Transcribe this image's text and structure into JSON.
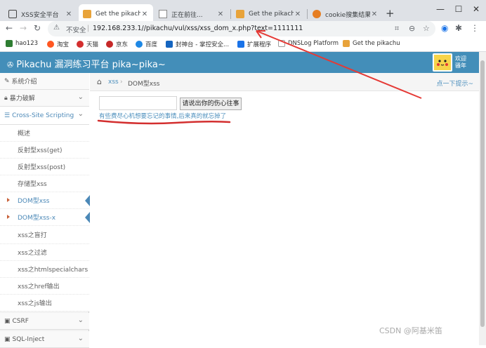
{
  "browser": {
    "tabs": [
      {
        "label": "XSS安全平台",
        "icon": "xss-favicon"
      },
      {
        "label": "Get the pikachu",
        "icon": "pikachu-favicon"
      },
      {
        "label": "正在前往...",
        "icon": "page-favicon"
      },
      {
        "label": "Get the pikachu",
        "icon": "pikachu-favicon"
      },
      {
        "label": "cookie搜集结果",
        "icon": "cookie-favicon"
      }
    ],
    "new_tab": "+",
    "address": {
      "security_label": "不安全",
      "url": "192.168.233.1//pikachu/vul/xss/xss_dom_x.php?text=1111111"
    },
    "bookmarks": [
      {
        "label": "hao123",
        "color": "#2e7d32"
      },
      {
        "label": "淘宝",
        "color": "#ff5722"
      },
      {
        "label": "天猫",
        "color": "#d32f2f"
      },
      {
        "label": "京东",
        "color": "#c62828"
      },
      {
        "label": "百度",
        "color": "#1e88e5"
      },
      {
        "label": "封神台 - 掌控安全...",
        "color": "#1565c0"
      },
      {
        "label": "扩展程序",
        "color": "#1a73e8"
      },
      {
        "label": "DNSLog Platform",
        "color": "#9e9e9e"
      },
      {
        "label": "Get the pikachu",
        "color": "#e8a33a"
      }
    ]
  },
  "page": {
    "title": "Pikachu 漏洞练习平台 pika~pika~",
    "welcome_line1": "欢迎",
    "welcome_line2": "骚年",
    "accent": "#438eb9"
  },
  "sidebar": {
    "groups": [
      {
        "label": "系统介绍",
        "icon": "wrench-icon"
      },
      {
        "label": "暴力破解",
        "icon": "lock-icon"
      },
      {
        "label": "Cross-Site Scripting",
        "icon": "list-icon"
      }
    ],
    "sub_items": [
      "概述",
      "反射型xss(get)",
      "反射型xss(post)",
      "存储型xss",
      "DOM型xss",
      "DOM型xss-x",
      "xss之盲打",
      "xss之过滤",
      "xss之htmlspecialchars",
      "xss之href输出",
      "xss之js输出"
    ],
    "bottom_groups": [
      {
        "label": "CSRF"
      },
      {
        "label": "SQL-Inject"
      }
    ]
  },
  "breadcrumb": {
    "parent": "xss",
    "separator": "›",
    "current": "DOM型xss",
    "hint": "点一下提示~"
  },
  "main": {
    "input_value": "",
    "button_label": "请说出你的伤心往事",
    "link_text": "有些费尽心机想要忘记的事情,后来真的就忘掉了"
  },
  "watermark": "CSDN @阿基米笛"
}
